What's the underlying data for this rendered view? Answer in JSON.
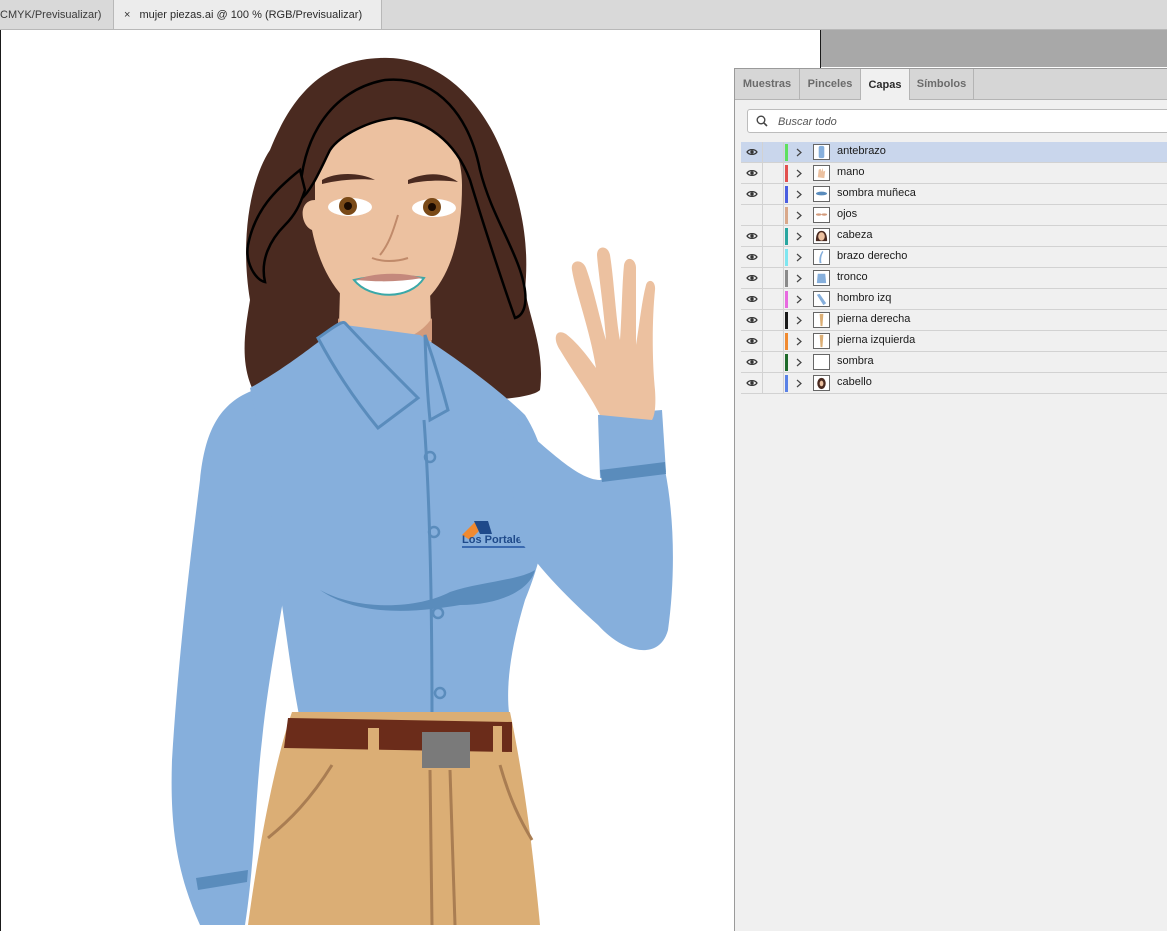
{
  "doc_tabs": [
    {
      "label": "CMYK/Previsualizar)",
      "active": false
    },
    {
      "label": "mujer piezas.ai @ 100 % (RGB/Previsualizar)",
      "active": true,
      "close_glyph": "×"
    }
  ],
  "artwork": {
    "logo_text": "Los Portales"
  },
  "panel": {
    "tabs": [
      "Muestras",
      "Pinceles",
      "Capas",
      "Símbolos"
    ],
    "active_tab": "Capas",
    "search": {
      "placeholder": "Buscar todo",
      "value": ""
    },
    "layers": [
      {
        "name": "antebrazo",
        "color": "#5ee05e",
        "visible": true,
        "selected": true,
        "thumb": "blue-sleeve-icon"
      },
      {
        "name": "mano",
        "color": "#e2504e",
        "visible": true,
        "selected": false,
        "thumb": "hand-icon"
      },
      {
        "name": "sombra muñeca",
        "color": "#4a5ee0",
        "visible": true,
        "selected": false,
        "thumb": "wrist-shadow-icon"
      },
      {
        "name": "ojos",
        "color": "#d9a88a",
        "visible": false,
        "selected": false,
        "thumb": "eyes-icon"
      },
      {
        "name": "cabeza",
        "color": "#2aa6a0",
        "visible": true,
        "selected": false,
        "thumb": "head-icon"
      },
      {
        "name": "brazo derecho",
        "color": "#7fe6f0",
        "visible": true,
        "selected": false,
        "thumb": "arm-icon"
      },
      {
        "name": "tronco",
        "color": "#8a8a8a",
        "visible": true,
        "selected": false,
        "thumb": "torso-icon"
      },
      {
        "name": "hombro izq",
        "color": "#e86ae0",
        "visible": true,
        "selected": false,
        "thumb": "shoulder-icon"
      },
      {
        "name": "pierna derecha",
        "color": "#1a1a1a",
        "visible": true,
        "selected": false,
        "thumb": "leg-icon"
      },
      {
        "name": "pierna izquierda",
        "color": "#f08a30",
        "visible": true,
        "selected": false,
        "thumb": "leg-icon"
      },
      {
        "name": "sombra",
        "color": "#1e6a2a",
        "visible": true,
        "selected": false,
        "thumb": "shadow-icon"
      },
      {
        "name": "cabello",
        "color": "#5a82e6",
        "visible": true,
        "selected": false,
        "thumb": "hair-icon"
      }
    ]
  },
  "colors": {
    "skin": "#ecc1a0",
    "skin_shadow": "#d39b7c",
    "hair": "#4a2a20",
    "shirt": "#86afdc",
    "shirt_dark": "#5a8cbc",
    "pants": "#dbae75",
    "pants_line": "#a97d52",
    "belt": "#6b2c1a",
    "buckle": "#7a7a7a",
    "selection": "#c9d6ec"
  }
}
